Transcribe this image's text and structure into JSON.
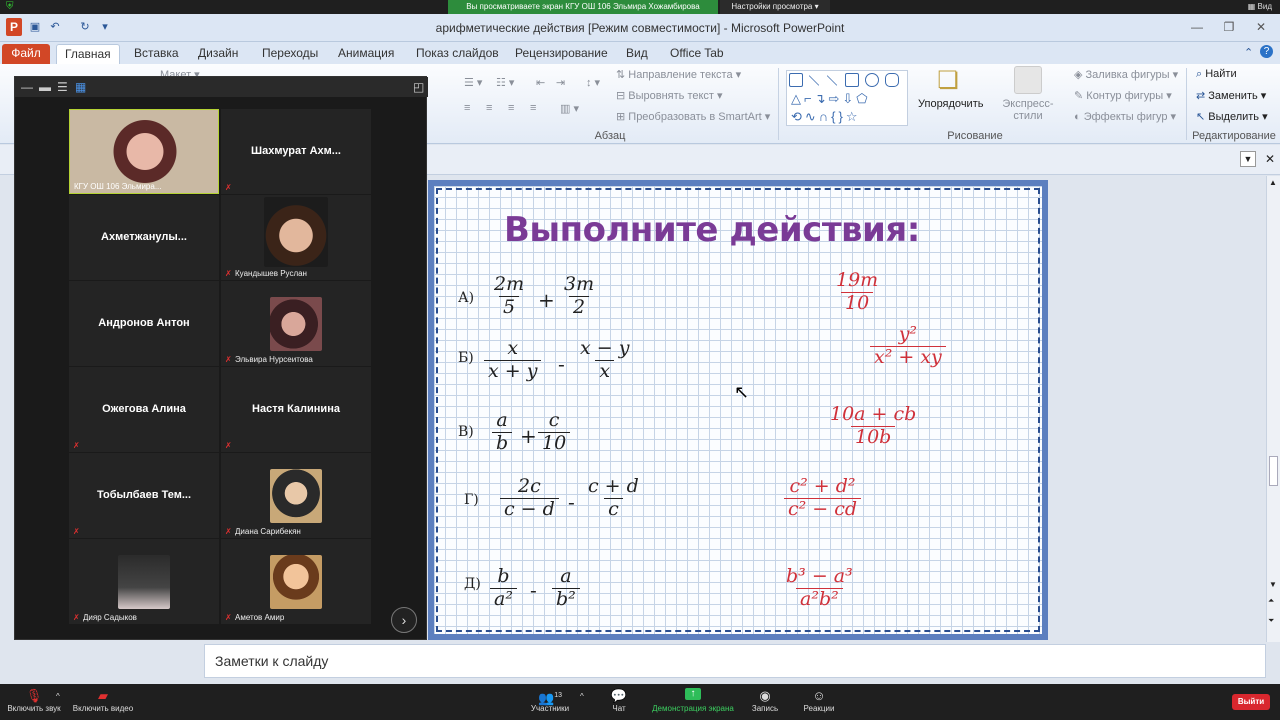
{
  "zoom_top": {
    "share_banner": "Вы просматриваете экран КГУ ОШ 106 Эльмира Хожамбирова",
    "view_settings": "Настройки просмотра ▾",
    "view_btn": "Вид"
  },
  "window": {
    "title": "арифметические действия [Режим совместимости] - Microsoft PowerPoint"
  },
  "ribbon": {
    "tabs": [
      "Файл",
      "Главная",
      "Вставка",
      "Дизайн",
      "Переходы",
      "Анимация",
      "Показ слайдов",
      "Рецензирование",
      "Вид",
      "Office Tab"
    ],
    "paragraph": {
      "text_direction": "Направление текста ▾",
      "align_text": "Выровнять текст ▾",
      "smartart": "Преобразовать в SmartArt ▾",
      "label": "Абзац"
    },
    "drawing": {
      "arrange": "Упорядочить",
      "quick_styles": "Экспресс-стили",
      "fill": "Заливка фигуры ▾",
      "outline": "Контур фигуры ▾",
      "effects": "Эффекты фигур ▾",
      "label": "Рисование"
    },
    "editing": {
      "find": "Найти",
      "replace": "Заменить ▾",
      "select": "Выделить ▾",
      "label": "Редактирование"
    },
    "layout_btn": "Макет ▾"
  },
  "slide": {
    "title": "Выполните действия:",
    "problems": [
      {
        "label": "А)",
        "left": {
          "num": "2m",
          "den": "5"
        },
        "op": "+",
        "right": {
          "num": "3m",
          "den": "2"
        }
      },
      {
        "label": "Б)",
        "left": {
          "num": "x",
          "den": "x + y"
        },
        "op": "-",
        "right": {
          "num": "x − y",
          "den": "x"
        }
      },
      {
        "label": "В)",
        "left": {
          "num": "a",
          "den": "b"
        },
        "op": "+",
        "right": {
          "num": "c",
          "den": "10"
        }
      },
      {
        "label": "Г)",
        "left": {
          "num": "2c",
          "den": "c − d"
        },
        "op": "-",
        "right": {
          "num": "c + d",
          "den": "c"
        }
      },
      {
        "label": "Д)",
        "left": {
          "num": "b",
          "den": "a²"
        },
        "op": "-",
        "right": {
          "num": "a",
          "den": "b²"
        }
      }
    ],
    "answers": [
      {
        "num": "19m",
        "den": "10"
      },
      {
        "num": "y²",
        "den": "x² + xy"
      },
      {
        "num": "10a + cb",
        "den": "10b"
      },
      {
        "num": "c² + d²",
        "den": "c² − cd"
      },
      {
        "num": "b³ − a³",
        "den": "a²b²"
      }
    ],
    "colors": {
      "title": "#7a3b96",
      "answer": "#d0313a",
      "border": "#5c7fbf"
    }
  },
  "notes": {
    "placeholder": "Заметки к слайду"
  },
  "gallery": {
    "participants": [
      {
        "name": "КГУ ОШ 106 Эльмира...",
        "video": true
      },
      {
        "name": "Шахмурат  Ахм...",
        "video": false
      },
      {
        "name": "Ахметжанулы...",
        "video": false
      },
      {
        "name": "Куандышев Руслан",
        "video": true
      },
      {
        "name": "Андронов Антон",
        "video": false
      },
      {
        "name": "Эльвира Нурсеитова",
        "video": true
      },
      {
        "name": "Ожегова Алина",
        "video": false
      },
      {
        "name": "Настя Калинина",
        "video": false
      },
      {
        "name": "Тобылбаев  Тем...",
        "video": false
      },
      {
        "name": "Диана Сарибекян",
        "video": true
      },
      {
        "name": "Дияр Садыков",
        "video": true
      },
      {
        "name": "Аметов Амир",
        "video": true
      }
    ]
  },
  "zoombar": {
    "unmute": "Включить звук",
    "start_video": "Включить видео",
    "participants": "Участники",
    "participants_count": "13",
    "chat": "Чат",
    "share": "Демонстрация экрана",
    "record": "Запись",
    "reactions": "Реакции",
    "exit": "Выйти"
  }
}
